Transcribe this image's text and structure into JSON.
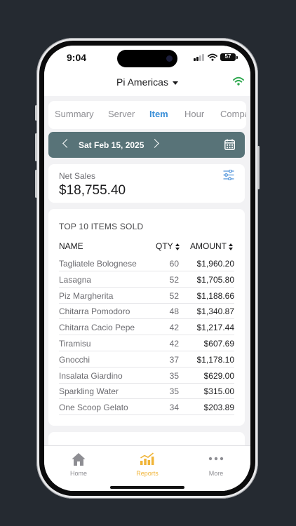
{
  "status": {
    "time": "9:04",
    "battery": "57"
  },
  "header": {
    "location": "Pi Americas"
  },
  "tabs": [
    {
      "label": "Summary"
    },
    {
      "label": "Server"
    },
    {
      "label": "Item",
      "active": true
    },
    {
      "label": "Hour"
    },
    {
      "label": "Compa"
    }
  ],
  "date": {
    "label": "Sat Feb 15, 2025"
  },
  "net_sales": {
    "label": "Net Sales",
    "value": "$18,755.40"
  },
  "top_items": {
    "title": "TOP 10 ITEMS SOLD",
    "columns": {
      "name": "NAME",
      "qty": "QTY",
      "amount": "AMOUNT"
    },
    "rows": [
      {
        "name": "Tagliatele Bolognese",
        "qty": "60",
        "amount": "$1,960.20"
      },
      {
        "name": "Lasagna",
        "qty": "52",
        "amount": "$1,705.80"
      },
      {
        "name": "Piz Margherita",
        "qty": "52",
        "amount": "$1,188.66"
      },
      {
        "name": "Chitarra Pomodoro",
        "qty": "48",
        "amount": "$1,340.87"
      },
      {
        "name": "Chitarra Cacio Pepe",
        "qty": "42",
        "amount": "$1,217.44"
      },
      {
        "name": "Tiramisu",
        "qty": "42",
        "amount": "$607.69"
      },
      {
        "name": "Gnocchi",
        "qty": "37",
        "amount": "$1,178.10"
      },
      {
        "name": "Insalata Giardino",
        "qty": "35",
        "amount": "$629.00"
      },
      {
        "name": "Sparkling Water",
        "qty": "35",
        "amount": "$315.00"
      },
      {
        "name": "One Scoop Gelato",
        "qty": "34",
        "amount": "$203.89"
      }
    ]
  },
  "nav": {
    "home": "Home",
    "reports": "Reports",
    "more": "More"
  },
  "colors": {
    "accent_blue": "#3a8fd8",
    "date_bar": "#587378",
    "active_nav": "#f0b437",
    "wifi_ok": "#2fa84f"
  },
  "icons": [
    "signal-icon",
    "wifi-icon",
    "battery-icon",
    "dropdown-caret-icon",
    "wifi-status-icon",
    "chevron-left-icon",
    "chevron-right-icon",
    "calendar-icon",
    "filter-sliders-icon",
    "sort-icon",
    "home-icon",
    "reports-chart-icon",
    "more-dots-icon"
  ]
}
